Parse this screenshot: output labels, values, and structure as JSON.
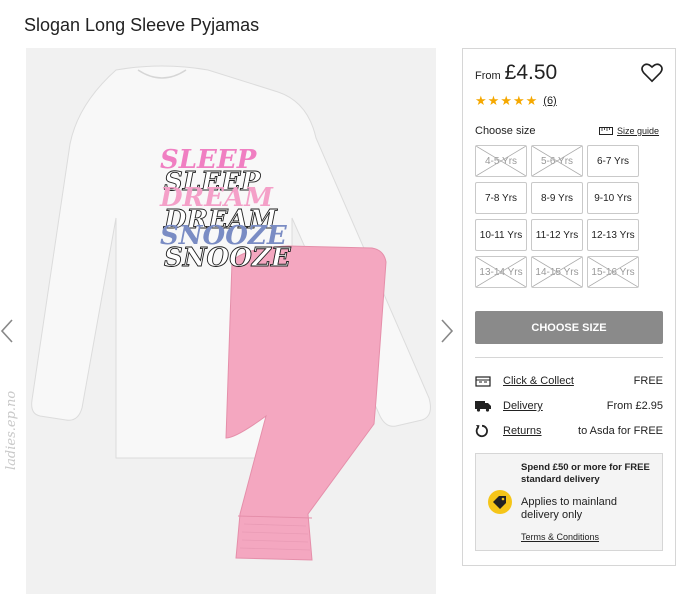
{
  "product": {
    "title": "Slogan Long Sleeve Pyjamas",
    "price_prefix": "From",
    "price": "£4.50",
    "rating_stars": 5,
    "review_count": "(6)"
  },
  "image": {
    "slogan_lines": [
      "SLEEP",
      "SLEEP",
      "DREAM",
      "DREAM",
      "SNOOZE",
      "SNOOZE"
    ],
    "watermark": "ladies.ep.no",
    "colors": {
      "background": "#f1f1f1",
      "top": "#f8f8f8",
      "bottoms": "#f4a7c0",
      "pink": "#f07fc2",
      "blue": "#7a8cc4"
    }
  },
  "sizes": {
    "label": "Choose size",
    "guide_label": "Size guide",
    "options": [
      {
        "label": "4-5 Yrs",
        "available": false
      },
      {
        "label": "5-6 Yrs",
        "available": false
      },
      {
        "label": "6-7 Yrs",
        "available": true
      },
      {
        "label": "7-8 Yrs",
        "available": true
      },
      {
        "label": "8-9 Yrs",
        "available": true
      },
      {
        "label": "9-10 Yrs",
        "available": true
      },
      {
        "label": "10-11 Yrs",
        "available": true
      },
      {
        "label": "11-12 Yrs",
        "available": true
      },
      {
        "label": "12-13 Yrs",
        "available": true
      },
      {
        "label": "13-14 Yrs",
        "available": false
      },
      {
        "label": "14-15 Yrs",
        "available": false
      },
      {
        "label": "15-16 Yrs",
        "available": false
      }
    ]
  },
  "cta": {
    "label": "CHOOSE SIZE",
    "color": "#8a8a8a"
  },
  "delivery": [
    {
      "icon": "store-icon",
      "label": "Click & Collect",
      "value": "FREE"
    },
    {
      "icon": "truck-icon",
      "label": "Delivery",
      "value": "From £2.95"
    },
    {
      "icon": "returns-icon",
      "label": "Returns",
      "value": "to Asda for FREE"
    }
  ],
  "promo": {
    "heading": "Spend £50 or more for FREE standard delivery",
    "body": "Applies to mainland delivery only",
    "terms": "Terms & Conditions",
    "icon": "price-tag-icon",
    "accent": "#f5c518"
  }
}
